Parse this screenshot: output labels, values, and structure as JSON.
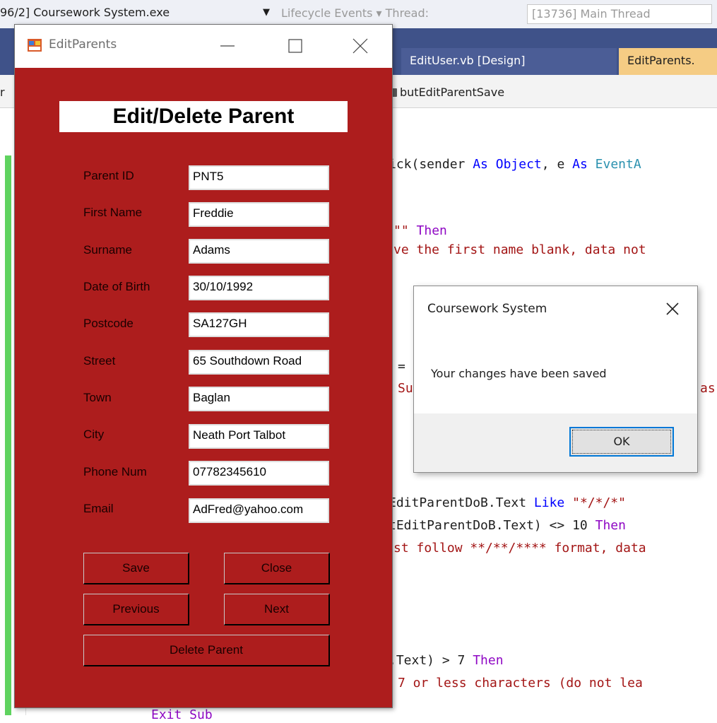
{
  "ide": {
    "process": "96/2] Coursework System.exe",
    "lifecycle": "Lifecycle Events ▾ Thread:",
    "thread": "[13736] Main Thread",
    "tabs": [
      "EditUser.vb [Design]",
      "EditParents."
    ],
    "nav_method": "butEditParentSave",
    "nav_left_glyph": "r",
    "code_lines": [
      {
        "pre": "ick(sender ",
        "kw": "As",
        "mid": " ",
        "kw2": "Object",
        "post": ", e ",
        "kw3": "As",
        "type": " EventA"
      },
      {
        "str_pre": "\"\" ",
        "kw": "Then"
      },
      {
        "str": "ve the first name blank, data not"
      },
      {
        "text": "="
      },
      {
        "str": "Su"
      },
      {
        "str": "as"
      },
      {
        "pre": "EditParentDoB.Text ",
        "kw": "Like",
        "str": " \"*/*/*\""
      },
      {
        "pre": "tEditParentDoB.Text) <> 10 ",
        "kw": "Then"
      },
      {
        "str": "st follow **/**/**** format, data"
      },
      {
        "pre": ".Text) > 7 ",
        "kw": "Then"
      },
      {
        "str": "7 or less characters (do not lea"
      },
      {
        "kw": "Exit Sub"
      }
    ]
  },
  "window": {
    "title": "EditParents",
    "heading": "Edit/Delete Parent",
    "fields": [
      {
        "label": "Parent ID",
        "value": "PNT5"
      },
      {
        "label": "First Name",
        "value": "Freddie"
      },
      {
        "label": "Surname",
        "value": "Adams"
      },
      {
        "label": "Date of Birth",
        "value": "30/10/1992"
      },
      {
        "label": "Postcode",
        "value": "SA127GH"
      },
      {
        "label": "Street",
        "value": "65 Southdown Road"
      },
      {
        "label": "Town",
        "value": "Baglan"
      },
      {
        "label": "City",
        "value": "Neath Port Talbot"
      },
      {
        "label": "Phone Num",
        "value": "07782345610"
      },
      {
        "label": "Email",
        "value": "AdFred@yahoo.com"
      }
    ],
    "buttons": {
      "save": "Save",
      "close": "Close",
      "previous": "Previous",
      "next": "Next",
      "delete": "Delete Parent"
    },
    "colors": {
      "form_bg": "#ad1d1d"
    }
  },
  "messagebox": {
    "title": "Coursework System",
    "message": "Your changes have been saved",
    "ok": "OK"
  },
  "icons": [
    "app-icon",
    "minimize-icon",
    "maximize-icon",
    "close-icon",
    "method-icon"
  ]
}
